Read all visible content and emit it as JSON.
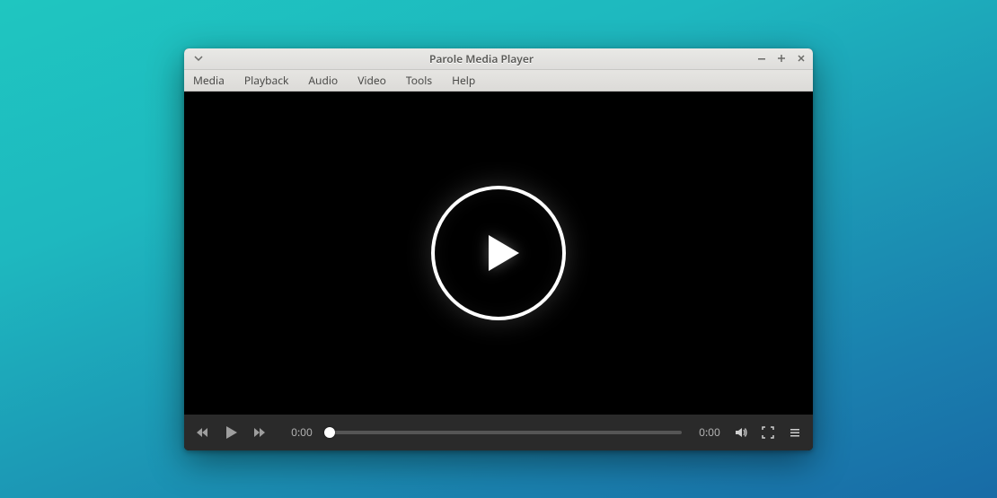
{
  "window": {
    "title": "Parole Media Player"
  },
  "menubar": {
    "items": [
      {
        "label": "Media"
      },
      {
        "label": "Playback"
      },
      {
        "label": "Audio"
      },
      {
        "label": "Video"
      },
      {
        "label": "Tools"
      },
      {
        "label": "Help"
      }
    ]
  },
  "controls": {
    "elapsed": "0:00",
    "duration": "0:00"
  }
}
